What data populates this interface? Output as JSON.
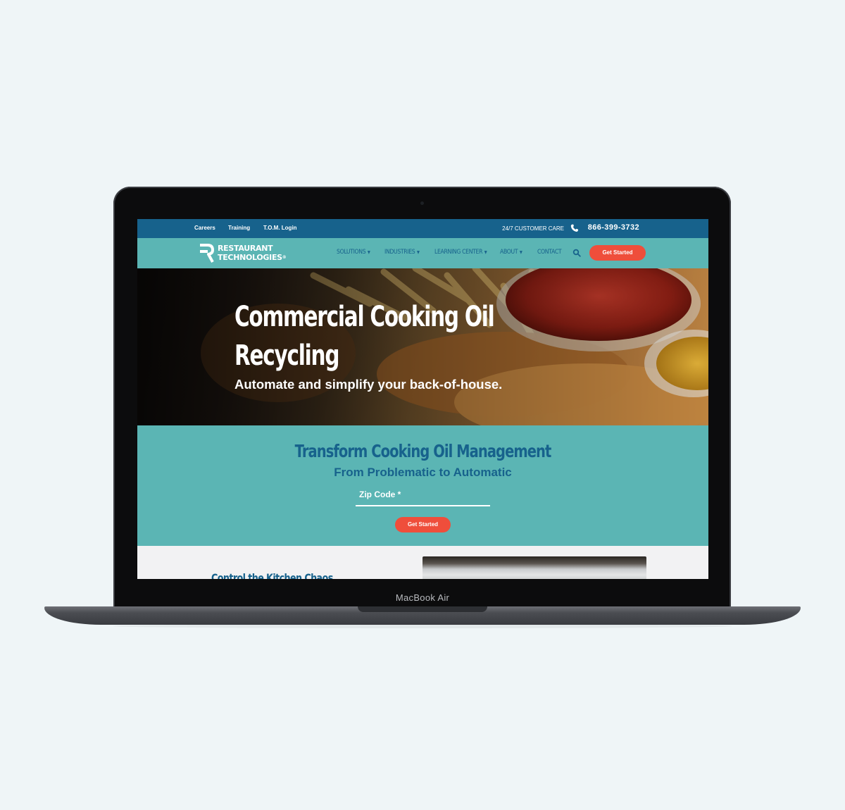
{
  "device": {
    "label": "MacBook Air"
  },
  "topbar": {
    "links": [
      "Careers",
      "Training",
      "T.O.M. Login"
    ],
    "care_label": "24/7 CUSTOMER CARE",
    "phone": "866-399-3732"
  },
  "nav": {
    "logo_line1": "RESTAURANT",
    "logo_line2": "TECHNOLOGIES",
    "items": [
      {
        "label": "SOLUTIONS",
        "dropdown": true
      },
      {
        "label": "INDUSTRIES",
        "dropdown": true
      },
      {
        "label": "LEARNING CENTER",
        "dropdown": true
      },
      {
        "label": "ABOUT",
        "dropdown": true
      },
      {
        "label": "CONTACT",
        "dropdown": false
      }
    ],
    "cta": "Get Started"
  },
  "hero": {
    "title": "Commercial Cooking Oil Recycling",
    "subtitle": "Automate and simplify your back-of-house."
  },
  "cta_section": {
    "title": "Transform Cooking Oil Management",
    "subtitle": "From Problematic to Automatic",
    "zip_label": "Zip Code *",
    "button": "Get Started"
  },
  "next_section": {
    "title": "Control the Kitchen Chaos"
  },
  "colors": {
    "brand_blue": "#17628c",
    "brand_teal": "#5bb5b4",
    "accent_red": "#ef4e3b"
  }
}
